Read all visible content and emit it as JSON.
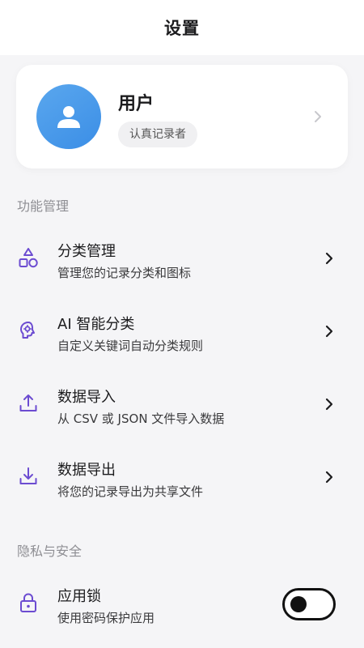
{
  "header": {
    "title": "设置"
  },
  "profile": {
    "name": "用户",
    "badge": "认真记录者"
  },
  "colors": {
    "accent": "#6c4cd1",
    "avatar": "#4a9bea",
    "background": "#f5f5f7"
  },
  "sections": {
    "features": {
      "label": "功能管理",
      "items": [
        {
          "title": "分类管理",
          "subtitle": "管理您的记录分类和图标",
          "icon": "shapes-icon"
        },
        {
          "title": "AI 智能分类",
          "subtitle": "自定义关键词自动分类规则",
          "icon": "ai-brain-icon"
        },
        {
          "title": "数据导入",
          "subtitle": "从 CSV 或 JSON 文件导入数据",
          "icon": "upload-icon"
        },
        {
          "title": "数据导出",
          "subtitle": "将您的记录导出为共享文件",
          "icon": "download-icon"
        }
      ]
    },
    "privacy": {
      "label": "隐私与安全",
      "items": [
        {
          "title": "应用锁",
          "subtitle": "使用密码保护应用",
          "icon": "lock-icon",
          "toggle_on": false
        }
      ]
    }
  }
}
